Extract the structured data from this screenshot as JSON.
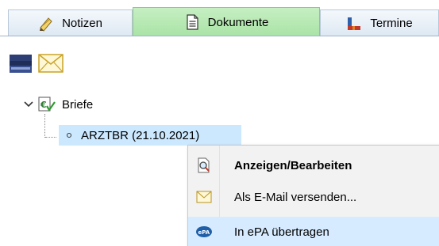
{
  "tabs": [
    {
      "label": "Notizen",
      "icon": "notes-icon",
      "active": false
    },
    {
      "label": "Dokumente",
      "icon": "document-icon",
      "active": true
    },
    {
      "label": "Termine",
      "icon": "calendar-icon",
      "active": false
    }
  ],
  "toolbar": {
    "scanner_icon": "scanner-icon",
    "mail_icon": "envelope-icon"
  },
  "tree": {
    "root_label": "Briefe",
    "child_label": "ARZTBR (21.10.2021)"
  },
  "context_menu": {
    "items": [
      {
        "label": "Anzeigen/Bearbeiten",
        "icon": "view-edit-icon",
        "bold": true
      },
      {
        "label": "Als E-Mail versenden...",
        "icon": "envelope-icon",
        "bold": false
      },
      {
        "label": "In ePA übertragen",
        "icon": "epa-icon",
        "bold": false
      }
    ]
  },
  "colors": {
    "active_tab": "#a9e3a6",
    "selection": "#cce8ff",
    "menu_hover": "#d6ebff",
    "tab_border": "#b8c7d8"
  }
}
